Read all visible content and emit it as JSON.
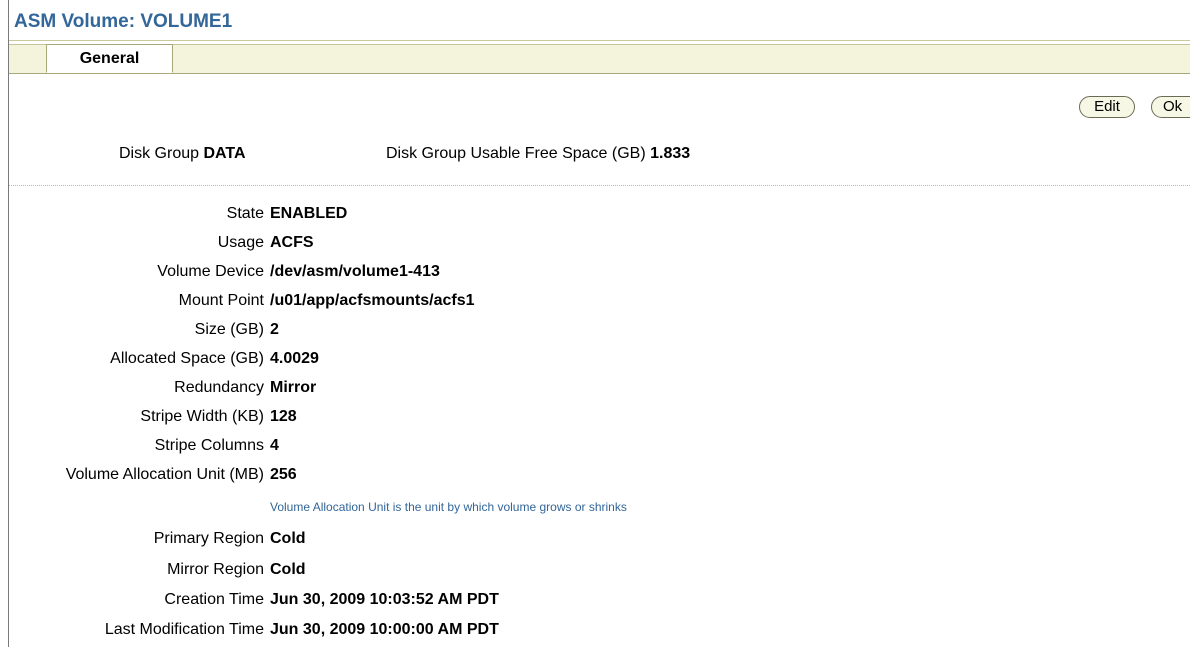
{
  "title": "ASM Volume: VOLUME1",
  "tabs": [
    {
      "label": "General",
      "active": true
    }
  ],
  "buttons": {
    "edit": "Edit",
    "ok": "Ok"
  },
  "summary": {
    "disk_group_label": "Disk Group",
    "disk_group_value": "DATA",
    "free_space_label": "Disk Group Usable Free Space (GB)",
    "free_space_value": "1.833"
  },
  "properties": [
    {
      "label": "State",
      "value": "ENABLED"
    },
    {
      "label": "Usage",
      "value": "ACFS"
    },
    {
      "label": "Volume Device",
      "value": "/dev/asm/volume1-413"
    },
    {
      "label": "Mount Point",
      "value": "/u01/app/acfsmounts/acfs1"
    },
    {
      "label": "Size (GB)",
      "value": "2"
    },
    {
      "label": "Allocated Space (GB)",
      "value": "4.0029"
    },
    {
      "label": "Redundancy",
      "value": "Mirror"
    },
    {
      "label": "Stripe Width (KB)",
      "value": "128"
    },
    {
      "label": "Stripe Columns",
      "value": "4"
    },
    {
      "label": "Volume Allocation Unit (MB)",
      "value": "256"
    },
    {
      "label": "Primary Region",
      "value": "Cold"
    },
    {
      "label": "Mirror Region",
      "value": "Cold"
    },
    {
      "label": "Creation Time",
      "value": "Jun 30, 2009 10:03:52 AM PDT"
    },
    {
      "label": "Last Modification Time",
      "value": "Jun 30, 2009 10:00:00 AM PDT"
    }
  ],
  "allocation_unit_hint": "Volume Allocation Unit is the unit by which volume grows or shrinks",
  "colors": {
    "title": "#336699",
    "tabbar": "#f4f4dc",
    "hint": "#336699"
  }
}
